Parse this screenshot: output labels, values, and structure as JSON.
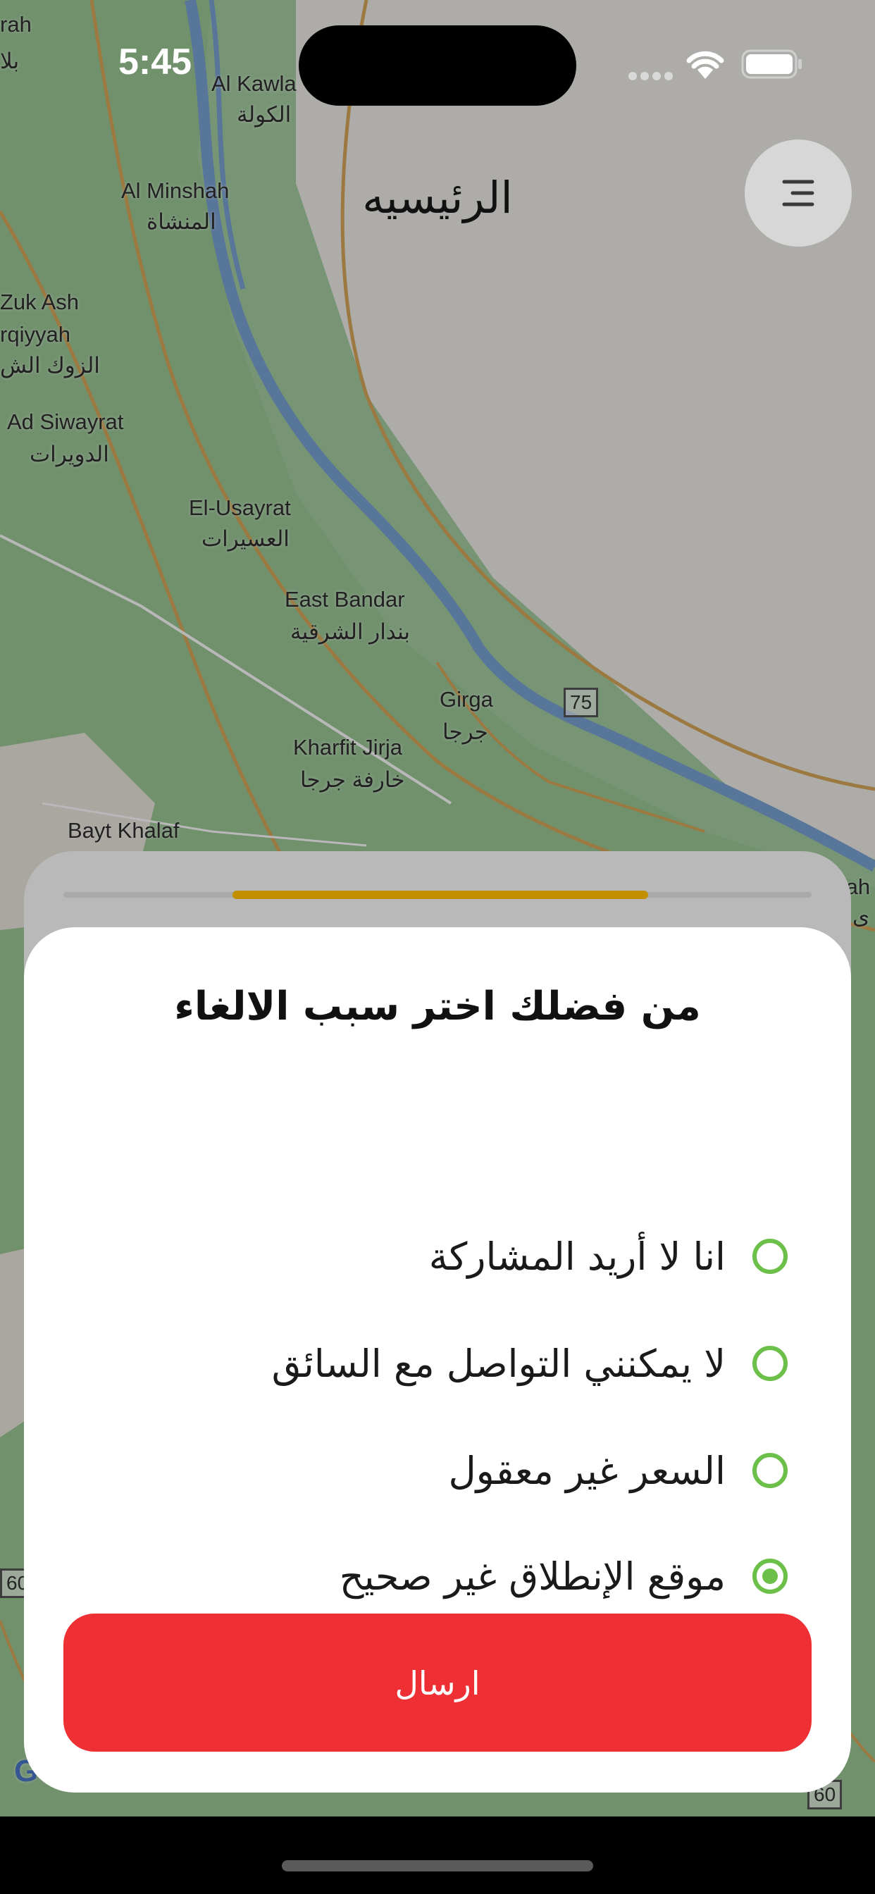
{
  "status": {
    "time": "5:45"
  },
  "header": {
    "title": "الرئيسيه"
  },
  "map": {
    "labels": [
      "rah",
      "بلا",
      "Al Kawla",
      "الكولة",
      "Al Minshah",
      "المنشاة",
      "Zuk Ash",
      "rqiyyah",
      "الزوك الش",
      "Ad Siwayrat",
      "الدويرات",
      "El-Usayrat",
      "العسيرات",
      "East Bandar",
      "بندار الشرقية",
      "Girga",
      "جرجا",
      "Kharfit Jirja",
      "خارفة جرجا",
      "Bayt Khalaf",
      "tah",
      "ى"
    ],
    "shields": [
      "75",
      "60",
      "60"
    ],
    "attribution": "Go"
  },
  "modal": {
    "title": "من فضلك اختر سبب الالغاء",
    "options": [
      {
        "label": "انا لا أريد المشاركة",
        "selected": false
      },
      {
        "label": "لا يمكنني التواصل مع السائق",
        "selected": false
      },
      {
        "label": "السعر غير معقول",
        "selected": false
      },
      {
        "label": "موقع الإنطلاق غير صحيح",
        "selected": true
      }
    ],
    "submit_label": "ارسال"
  },
  "colors": {
    "accent_green": "#6cc04a",
    "submit_red": "#ee3035",
    "progress_gold": "#c28f00"
  }
}
